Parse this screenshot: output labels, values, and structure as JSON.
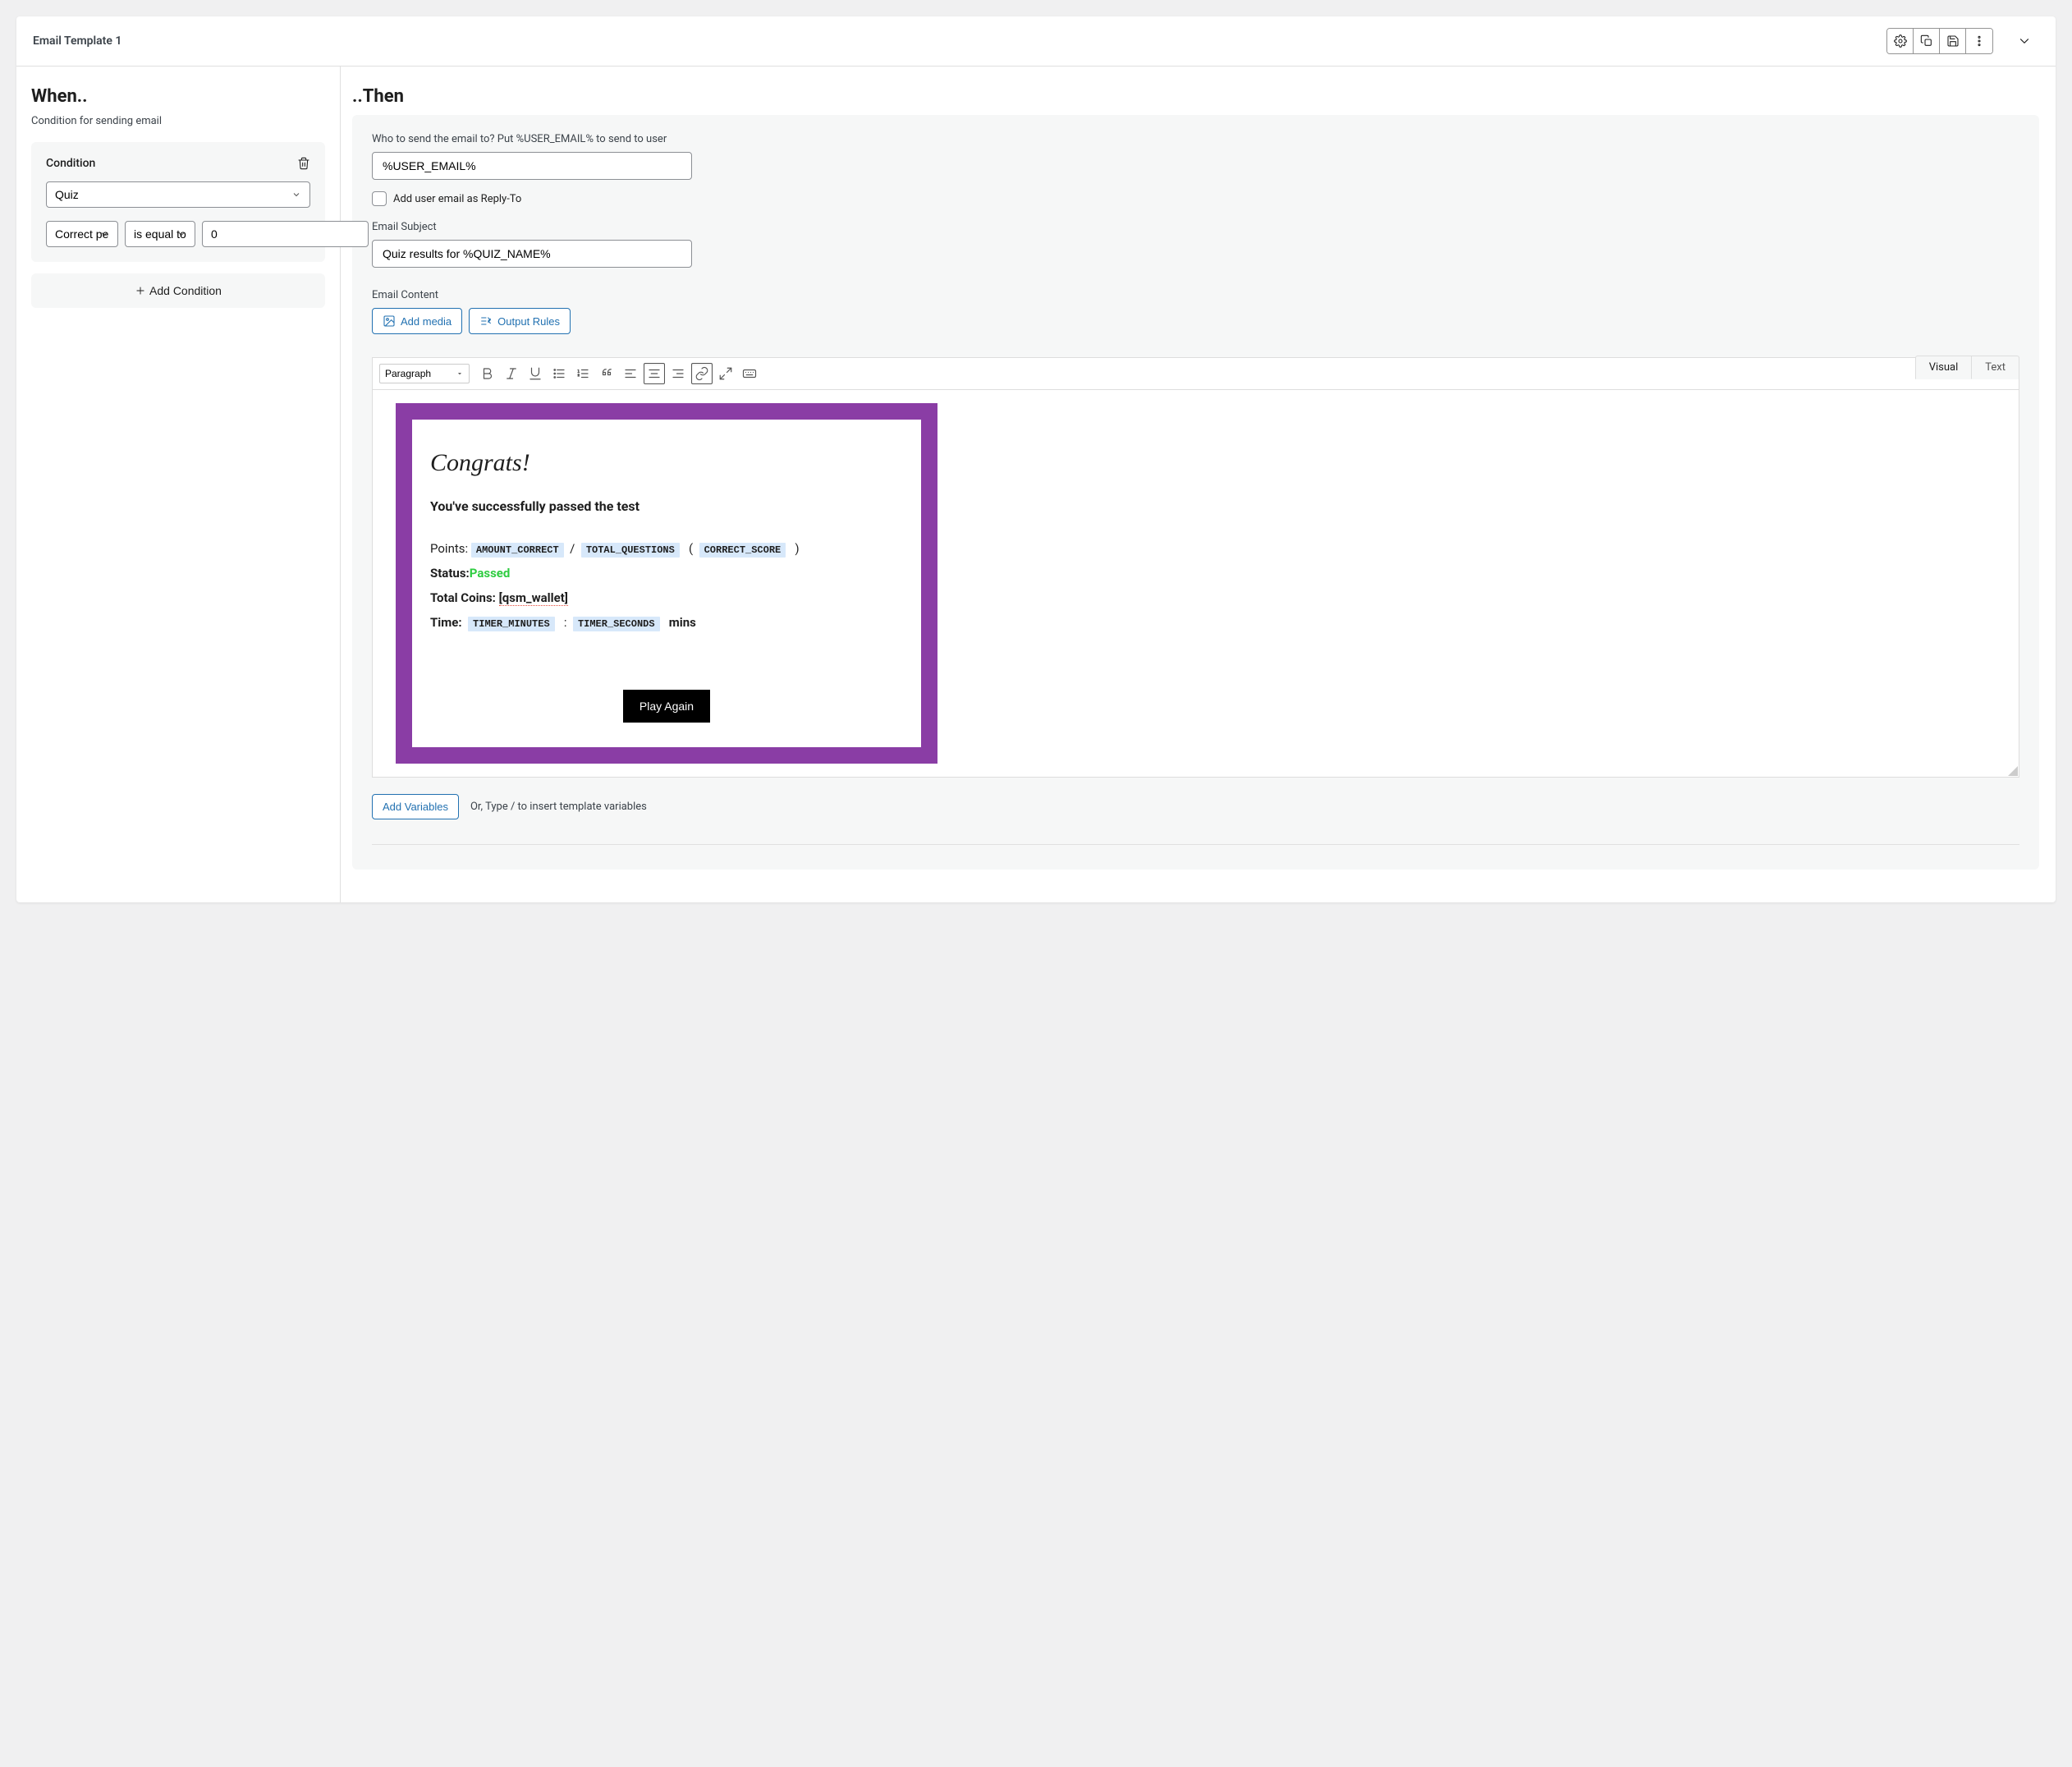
{
  "header": {
    "title": "Email Template 1"
  },
  "when": {
    "title": "When..",
    "subtitle": "Condition for sending email",
    "condition_label": "Condition",
    "select_quiz": "Quiz",
    "select_field": "Correct pe",
    "select_op": "is equal to",
    "value": "0",
    "add_condition": "Add Condition"
  },
  "then": {
    "title": "..Then",
    "who_label": "Who to send the email to? Put %USER_EMAIL% to send to user",
    "who_value": "%USER_EMAIL%",
    "reply_to_label": "Add user email as Reply-To",
    "subject_label": "Email Subject",
    "subject_value": "Quiz results for %QUIZ_NAME%",
    "content_label": "Email Content",
    "add_media": "Add media",
    "output_rules": "Output Rules",
    "tab_visual": "Visual",
    "tab_text": "Text",
    "format_select": "Paragraph",
    "add_variables": "Add Variables",
    "hint": "Or, Type / to insert template variables"
  },
  "template": {
    "congrats": "Congrats!",
    "passed": "You've successfully passed the test",
    "points_label": "Points:",
    "var_amount_correct": "AMOUNT_CORRECT",
    "slash": "/",
    "var_total_questions": "TOTAL_QUESTIONS",
    "open_paren": "(",
    "var_correct_score": "CORRECT_SCORE",
    "close_paren": ")",
    "status_label": "Status:",
    "status_value": "Passed",
    "coins_label": "Total Coins: ",
    "coins_value": "[qsm_wallet]",
    "time_label": "Time:",
    "var_timer_minutes": "TIMER_MINUTES",
    "colon": ":",
    "var_timer_seconds": "TIMER_SECONDS",
    "mins": "mins",
    "play_again": "Play Again"
  }
}
